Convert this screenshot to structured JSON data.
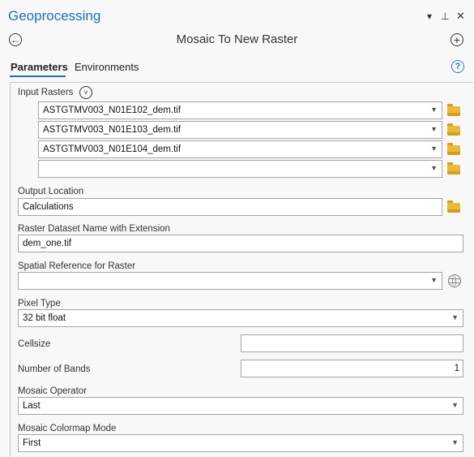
{
  "pane": {
    "title": "Geoprocessing",
    "options_icon": "chevron-down-icon",
    "pin_icon": "pin-icon",
    "close_icon": "close-icon"
  },
  "tool": {
    "name": "Mosaic To New Raster",
    "back_icon": "back-arrow-icon",
    "add_icon": "add-icon"
  },
  "tabs": [
    {
      "label": "Parameters",
      "active": true
    },
    {
      "label": "Environments",
      "active": false
    }
  ],
  "help_icon": "help-icon",
  "params": {
    "input_rasters": {
      "label": "Input Rasters",
      "values": [
        "ASTGTMV003_N01E102_dem.tif",
        "ASTGTMV003_N01E103_dem.tif",
        "ASTGTMV003_N01E104_dem.tif",
        ""
      ]
    },
    "output_location": {
      "label": "Output Location",
      "value": "Calculations"
    },
    "dataset_name": {
      "label": "Raster Dataset Name with Extension",
      "value": "dem_one.tif"
    },
    "spatial_reference": {
      "label": "Spatial Reference for  Raster",
      "value": ""
    },
    "pixel_type": {
      "label": "Pixel Type",
      "value": "32 bit float"
    },
    "cellsize": {
      "label": "Cellsize",
      "value": ""
    },
    "number_of_bands": {
      "label": "Number of Bands",
      "value": "1"
    },
    "mosaic_operator": {
      "label": "Mosaic Operator",
      "value": "Last"
    },
    "colormap_mode": {
      "label": "Mosaic Colormap Mode",
      "value": "First"
    }
  },
  "colors": {
    "accent": "#1f6fb2",
    "folder": "#e8b93a"
  }
}
